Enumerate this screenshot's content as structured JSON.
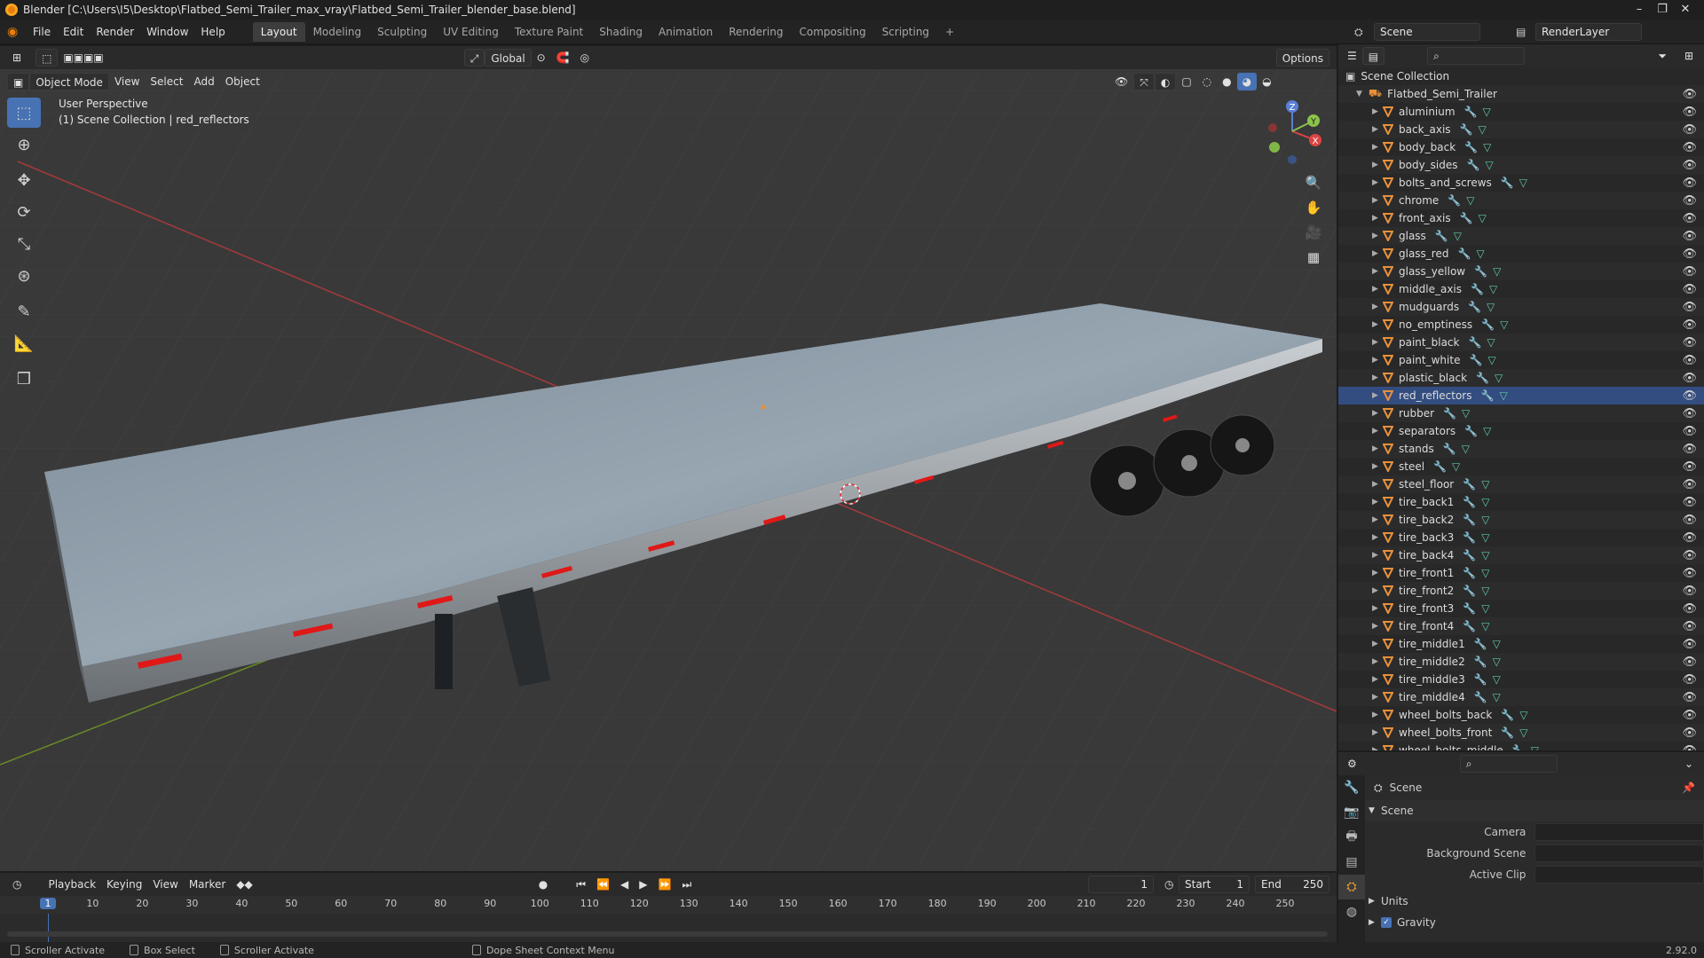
{
  "window": {
    "title": "Blender [C:\\Users\\I5\\Desktop\\Flatbed_Semi_Trailer_max_vray\\Flatbed_Semi_Trailer_blender_base.blend]",
    "controls": [
      "–",
      "❐",
      "✕"
    ]
  },
  "menus": [
    "File",
    "Edit",
    "Render",
    "Window",
    "Help"
  ],
  "workspaces": [
    {
      "label": "Layout",
      "active": true
    },
    {
      "label": "Modeling"
    },
    {
      "label": "Sculpting"
    },
    {
      "label": "UV Editing"
    },
    {
      "label": "Texture Paint"
    },
    {
      "label": "Shading"
    },
    {
      "label": "Animation"
    },
    {
      "label": "Rendering"
    },
    {
      "label": "Compositing"
    },
    {
      "label": "Scripting"
    }
  ],
  "add_workspace": "+",
  "scene_field": "Scene",
  "view_layer_field": "RenderLayer",
  "viewport": {
    "transform_orientation": "Global",
    "options": "Options",
    "mode": "Object Mode",
    "menus": [
      "View",
      "Select",
      "Add",
      "Object"
    ],
    "overlay_text_1": "User Perspective",
    "overlay_text_2": "(1) Scene Collection | red_reflectors",
    "gizmo": {
      "x": "X",
      "y": "Y",
      "z": "Z"
    }
  },
  "outliner": {
    "root": "Scene Collection",
    "collection": "Flatbed_Semi_Trailer",
    "selected": "red_reflectors",
    "items": [
      "aluminium",
      "back_axis",
      "body_back",
      "body_sides",
      "bolts_and_screws",
      "chrome",
      "front_axis",
      "glass",
      "glass_red",
      "glass_yellow",
      "middle_axis",
      "mudguards",
      "no_emptiness",
      "paint_black",
      "paint_white",
      "plastic_black",
      "red_reflectors",
      "rubber",
      "separators",
      "stands",
      "steel",
      "steel_floor",
      "tire_back1",
      "tire_back2",
      "tire_back3",
      "tire_back4",
      "tire_front1",
      "tire_front2",
      "tire_front3",
      "tire_front4",
      "tire_middle1",
      "tire_middle2",
      "tire_middle3",
      "tire_middle4",
      "wheel_bolts_back",
      "wheel_bolts_front",
      "wheel_bolts_middle"
    ]
  },
  "properties": {
    "context": "Scene",
    "panel": "Scene",
    "fields": [
      {
        "label": "Camera"
      },
      {
        "label": "Background Scene"
      },
      {
        "label": "Active Clip"
      }
    ],
    "sub_panels": [
      "Units",
      "Gravity"
    ]
  },
  "timeline": {
    "menus": [
      "Playback",
      "Keying",
      "View",
      "Marker"
    ],
    "current_frame": "1",
    "start_label": "Start",
    "start": "1",
    "end_label": "End",
    "end": "250",
    "ticks": [
      "1",
      "10",
      "20",
      "30",
      "40",
      "50",
      "60",
      "70",
      "80",
      "90",
      "100",
      "110",
      "120",
      "130",
      "140",
      "150",
      "160",
      "170",
      "180",
      "190",
      "200",
      "210",
      "220",
      "230",
      "240",
      "250"
    ]
  },
  "statusbar": {
    "items": [
      "Scroller Activate",
      "Box Select",
      "Scroller Activate",
      "Dope Sheet Context Menu"
    ],
    "version": "2.92.0"
  },
  "colors": {
    "accent": "#4772b3",
    "selected_row": "#334d80",
    "mesh_orange": "#e8913a",
    "modifier_blue": "#7aa3e5",
    "data_green": "#5fc9a8",
    "axis_red": "#b83a3a",
    "axis_green": "#6a9a2a"
  }
}
